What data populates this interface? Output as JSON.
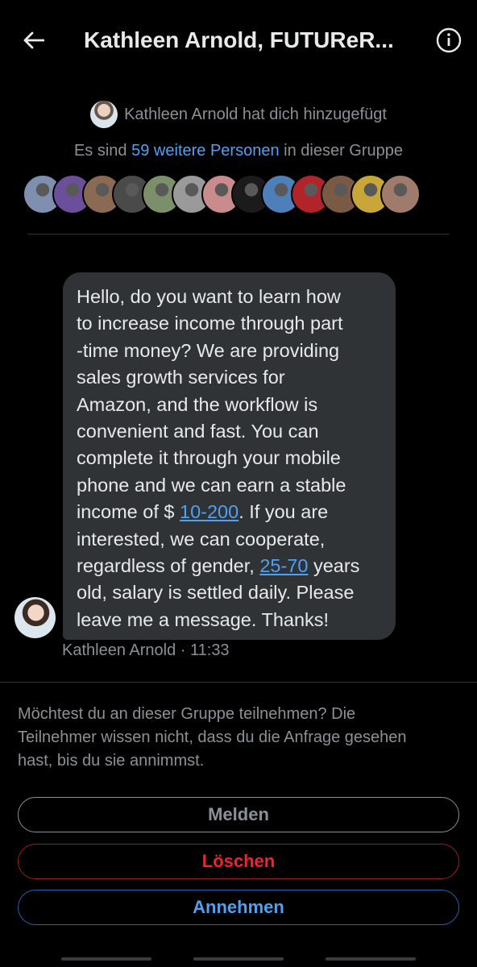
{
  "header": {
    "title": "Kathleen Arnold, FUTUReR...",
    "back_icon": "arrow-left-icon",
    "info_icon": "info-circle-icon"
  },
  "intro": {
    "added_text": "Kathleen Arnold hat dich hinzugefügt",
    "members_prefix": "Es sind",
    "members_count": "59 weitere Personen",
    "members_suffix": "in dieser Gruppe"
  },
  "member_avatars": [
    {
      "color": "#7f8fb0"
    },
    {
      "color": "#6b4f9a"
    },
    {
      "color": "#8a6a52"
    },
    {
      "color": "#4a4a4a"
    },
    {
      "color": "#7d8f6a"
    },
    {
      "color": "#9a9a9a"
    },
    {
      "color": "#c98b8b"
    },
    {
      "color": "#1b1b1b"
    },
    {
      "color": "#4f7fb8"
    },
    {
      "color": "#b0242a"
    },
    {
      "color": "#7a5a45"
    },
    {
      "color": "#c9a63a"
    },
    {
      "color": "#a07a6a"
    }
  ],
  "message": {
    "lines": [
      "Hello, do you want to learn how",
      "to increase income through part",
      "-time money? We are providing",
      "sales growth services for",
      "Amazon, and the workflow is",
      "convenient and fast. You can",
      "complete it through your mobile",
      "phone and we can earn a stable"
    ],
    "income_prefix": "income of $ ",
    "income_link": "10-200",
    "income_suffix": ". If you are",
    "line_interested": "interested, we can cooperate,",
    "gender_prefix": "regardless of gender, ",
    "age_link": "25-70",
    "age_suffix": " years",
    "line_salary": "old, salary is settled daily. Please",
    "line_leave": "leave me a message. Thanks!",
    "meta": "Kathleen Arnold · 11:33"
  },
  "prompt": {
    "lines": [
      "Möchtest du an dieser Gruppe teilnehmen? Die",
      "Teilnehmer wissen nicht, dass du die Anfrage gesehen",
      "hast, bis du sie annimmst."
    ]
  },
  "actions": {
    "report_label": "Melden",
    "delete_label": "Löschen",
    "accept_label": "Annehmen"
  },
  "colors": {
    "accent": "#4ea1f3",
    "danger": "#f4212e",
    "muted": "#8b9096",
    "bubble": "#2f3336"
  }
}
